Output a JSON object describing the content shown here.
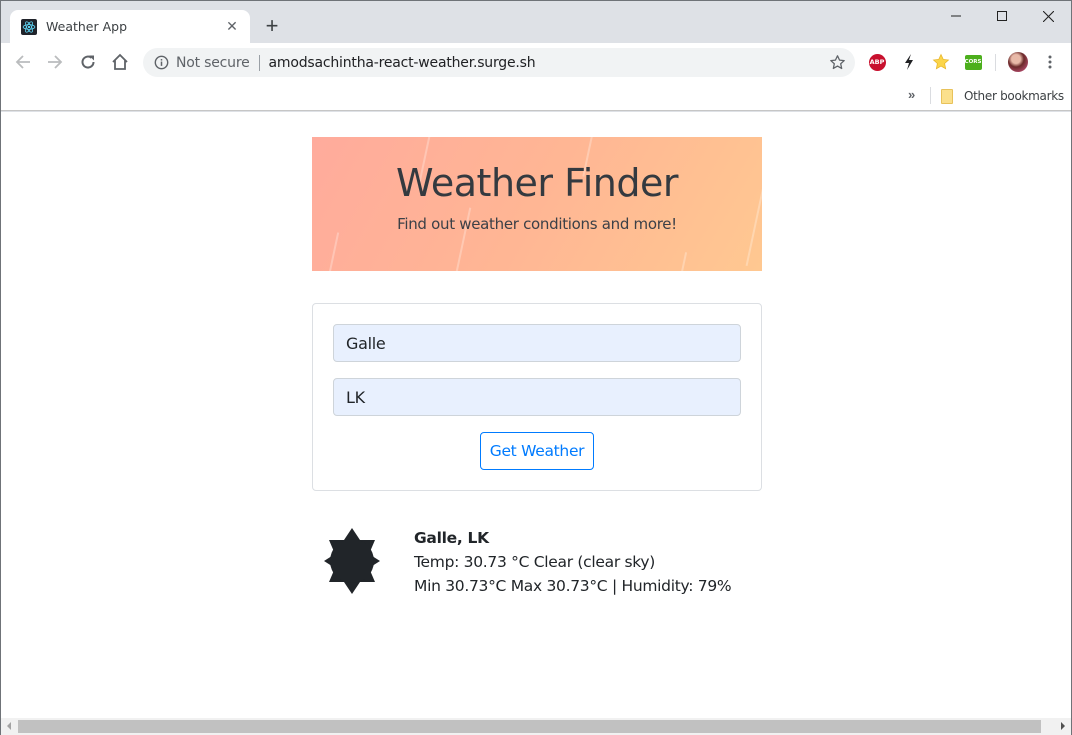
{
  "browser": {
    "tab": {
      "title": "Weather App",
      "favicon": "react-logo-icon"
    },
    "new_tab_label": "+",
    "window_controls": [
      "minimize",
      "maximize",
      "close"
    ],
    "omnibox": {
      "security_label": "Not secure",
      "url": "amodsachintha-react-weather.surge.sh"
    },
    "extensions": [
      {
        "name": "adblock-plus",
        "label": "ABP"
      },
      {
        "name": "lightning"
      },
      {
        "name": "star-extension"
      },
      {
        "name": "cors",
        "label": "CORS"
      }
    ],
    "bookmarks": {
      "overflow_label": "»",
      "other_bookmarks": "Other bookmarks"
    }
  },
  "page": {
    "banner": {
      "title": "Weather Finder",
      "subtitle": "Find out weather conditions and more!"
    },
    "form": {
      "city_value": "Galle",
      "country_value": "LK",
      "submit_label": "Get Weather"
    },
    "result": {
      "location": "Galle, LK",
      "temp_line": "Temp: 30.73 °C Clear (clear sky)",
      "details_line": "Min 30.73°C Max 30.73°C | Humidity: 79%",
      "icon": "clear-sky-sun-icon"
    }
  },
  "colors": {
    "accent": "#007bff",
    "banner_start": "#ffab9c",
    "banner_end": "#ffc891",
    "input_bg": "#e8f0fe",
    "text": "#212529"
  }
}
